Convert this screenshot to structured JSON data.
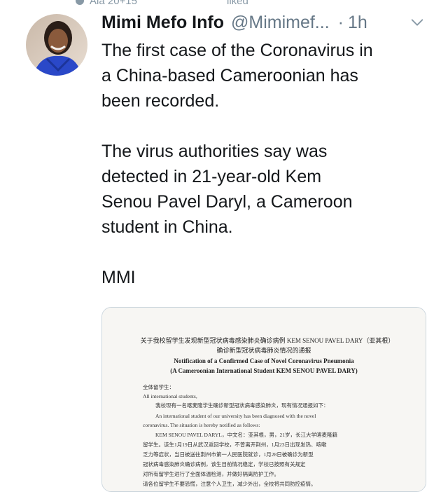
{
  "retweet_bar": {
    "left_text": "Ala 20+15",
    "right_text": "liked"
  },
  "tweet": {
    "author_name": "Mimi Mefo Info",
    "handle": "@Mimimef...",
    "separator": "·",
    "time": "1h",
    "paragraphs": [
      "The first case of the Coronavirus in\na China-based Cameroonian has\nbeen recorded.",
      "The virus authorities say was\ndetected in  21-year-old Kem\nSenou Pavel Daryl, a Cameroon\nstudent in China.",
      "MMI"
    ]
  },
  "attachment": {
    "doc_lines": {
      "cn_title_1": "关于我校留学生发现新型冠状病毒感染肺炎确诊病例 KEM SENOU PAVEL DARY（亚其根）",
      "cn_title_2": "确诊新型冠状病毒肺炎情况的通报",
      "en_title_1": "Notification of a Confirmed Case of Novel Coronavirus Pneumonia",
      "en_title_2": "(A Cameroonian International Student KEM SENOU PAVEL DARY)",
      "salutation_cn": "全体留学生：",
      "salutation_en": "All international students,",
      "body_cn_1": "我校现有一名喀麦隆学生确诊新型冠状病毒感染肺炎，现有情况通报如下：",
      "body_en_1": "An international student of our university has been diagnosed with the novel",
      "body_en_2": "coronavirus. The situation is hereby notified as follows:",
      "body_en_3": "KEM SENOU PAVEL DARYL，中文名：亚其根，男，21岁，长江大学喀麦隆籍",
      "body_cn_2": "留学生。该生1月19日从武汉返回学校，不曾离开荆州，1月23日出现发热、咳嗽",
      "body_cn_3": "乏力等症状，当日被送往荆州市第一人民医院就诊，1月28日被确诊为新型",
      "body_cn_4": "冠状病毒感染肺炎确诊病例，该生目前情况稳定，学校已按照有关规定",
      "body_cn_5": "对所有留学生进行了全面体温检测，并做好隔离防护工作。",
      "body_cn_6": "请各位留学生不要恐慌，注意个人卫生，减少外出，全校将共同防控疫情。"
    }
  },
  "colors": {
    "text_primary": "#14171a",
    "text_secondary": "#657786",
    "border": "#ccd6dd"
  },
  "icons": [
    "retweet-icon",
    "chevron-down-icon"
  ]
}
